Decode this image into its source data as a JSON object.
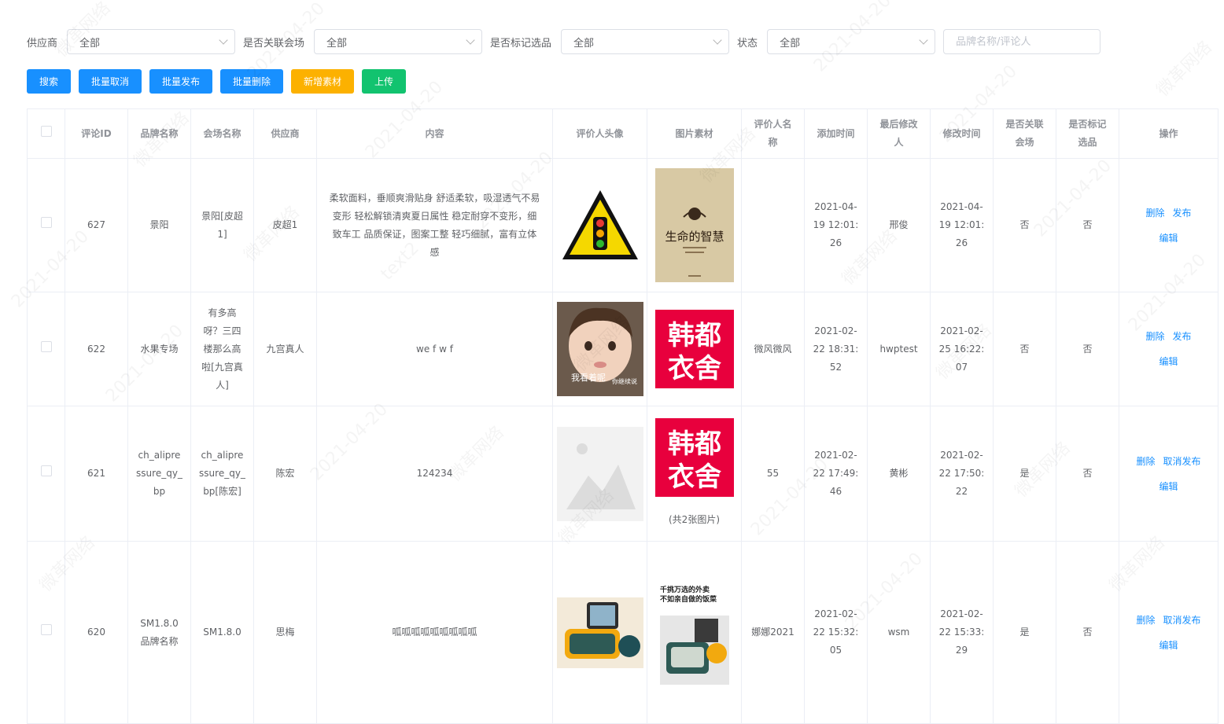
{
  "filters": {
    "supplier_label": "供应商",
    "supplier_value": "全部",
    "venue_label": "是否关联会场",
    "venue_value": "全部",
    "marked_label": "是否标记选品",
    "marked_value": "全部",
    "status_label": "状态",
    "status_value": "全部",
    "search_placeholder": "品牌名称/评论人"
  },
  "buttons": {
    "search": "搜索",
    "batch_cancel": "批量取消",
    "batch_publish": "批量发布",
    "batch_delete": "批量删除",
    "add_material": "新增素材",
    "upload": "上传"
  },
  "table": {
    "headers": [
      "评论ID",
      "品牌名称",
      "会场名称",
      "供应商",
      "内容",
      "评价人头像",
      "图片素材",
      "评价人名称",
      "添加时间",
      "最后修改人",
      "修改时间",
      "是否关联会场",
      "是否标记选品",
      "操作"
    ],
    "rows": [
      {
        "id": "627",
        "brand": "景阳",
        "venue": "景阳[皮超1]",
        "supplier": "皮超1",
        "content": "柔软面料，垂顺爽滑贴身 舒适柔软，吸湿透气不易变形 轻松解锁清爽夏日属性 稳定耐穿不变形，细致车工 品质保证，图案工整 轻巧细腻，富有立体感",
        "reviewer": "",
        "added": "2021-04-19 12:01:26",
        "modifier": "邢俊",
        "modified": "2021-04-19 12:01:26",
        "linked": "否",
        "marked": "否",
        "actions": [
          "删除",
          "发布",
          "编辑"
        ],
        "caption": ""
      },
      {
        "id": "622",
        "brand": "水果专场",
        "venue": "有多高呀？三四楼那么高啦[九宫真人]",
        "supplier": "九宫真人",
        "content": "we f w f",
        "reviewer": "微风微风",
        "added": "2021-02-22 18:31:52",
        "modifier": "hwptest",
        "modified": "2021-02-25 16:22:07",
        "linked": "否",
        "marked": "否",
        "actions": [
          "删除",
          "发布",
          "编辑"
        ],
        "caption": ""
      },
      {
        "id": "621",
        "brand": "ch_alipressure_qy_bp",
        "venue": "ch_alipressure_qy_bp[陈宏]",
        "supplier": "陈宏",
        "content": "124234",
        "reviewer": "55",
        "added": "2021-02-22 17:49:46",
        "modifier": "黄彬",
        "modified": "2021-02-22 17:50:22",
        "linked": "是",
        "marked": "否",
        "actions": [
          "删除",
          "取消发布",
          "编辑"
        ],
        "caption": "(共2张图片)"
      },
      {
        "id": "620",
        "brand": "SM1.8.0品牌名称",
        "venue": "SM1.8.0",
        "supplier": "思梅",
        "content": "呱呱呱呱呱呱呱呱呱",
        "reviewer": "娜娜2021",
        "added": "2021-02-22 15:32:05",
        "modifier": "wsm",
        "modified": "2021-02-22 15:33:29",
        "linked": "是",
        "marked": "否",
        "actions": [
          "删除",
          "取消发布",
          "编辑"
        ],
        "caption": ""
      }
    ]
  },
  "images": {
    "book_title": "生命的智慧",
    "brand_logo_top": "韩都",
    "brand_logo_bottom": "衣舍",
    "avatar_caption_1": "我看着呢",
    "avatar_caption_2": "你继续说",
    "food_title_1": "千挑万选的外卖",
    "food_title_2": "不如亲自做的饭菜"
  },
  "watermark": {
    "lines": [
      "微革网络",
      "2021-04-20",
      "text2"
    ]
  },
  "colors": {
    "primary": "#1890ff",
    "orange": "#fcb100",
    "green": "#12c36f",
    "logo_red": "#e8003d"
  }
}
